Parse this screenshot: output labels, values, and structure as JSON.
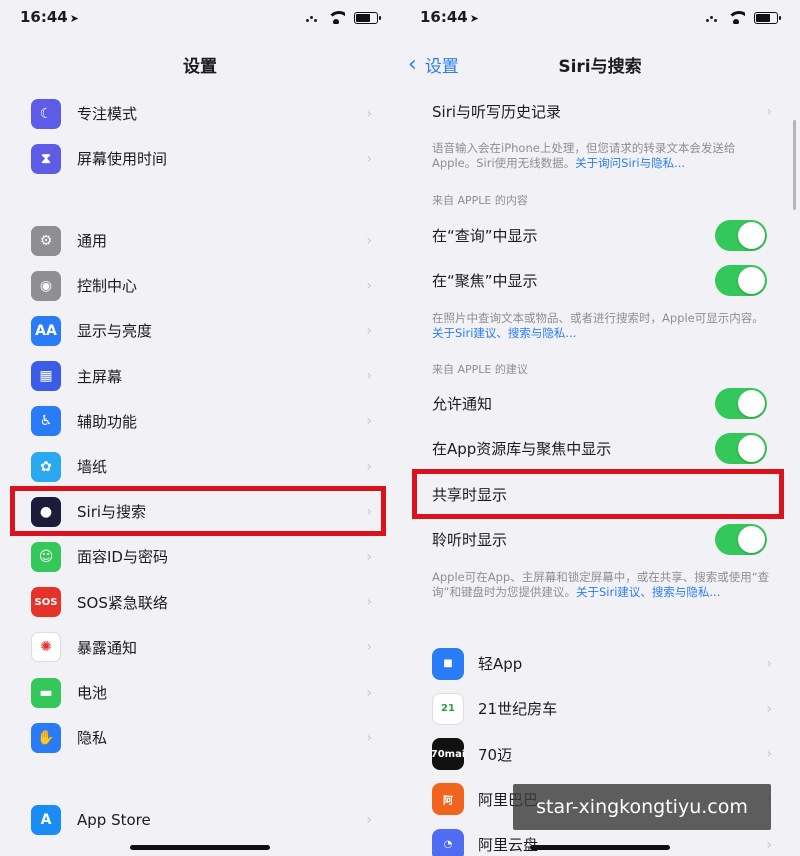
{
  "status": {
    "time": "16:44",
    "location_glyph": "➤"
  },
  "left": {
    "title": "设置",
    "group1": [
      {
        "label": "专注模式",
        "icon": "moon-icon",
        "color": "#5e5ce6",
        "glyph": "☾"
      },
      {
        "label": "屏幕使用时间",
        "icon": "hourglass-icon",
        "color": "#5e5ce6",
        "glyph": "⧗"
      }
    ],
    "group2": [
      {
        "label": "通用",
        "icon": "gear-icon",
        "color": "#8e8e93",
        "glyph": "⚙"
      },
      {
        "label": "控制中心",
        "icon": "toggles-icon",
        "color": "#8e8e93",
        "glyph": "◉"
      },
      {
        "label": "显示与亮度",
        "icon": "text-size-icon",
        "color": "#2a7cf6",
        "glyph": "AA"
      },
      {
        "label": "主屏幕",
        "icon": "home-grid-icon",
        "color": "#3a5ce6",
        "glyph": "▦"
      },
      {
        "label": "辅助功能",
        "icon": "accessibility-icon",
        "color": "#2a7cf6",
        "glyph": "♿"
      },
      {
        "label": "墙纸",
        "icon": "flower-icon",
        "color": "#2aa8f0",
        "glyph": "✿"
      },
      {
        "label": "Siri与搜索",
        "icon": "siri-icon",
        "color": "#1c1c3a",
        "glyph": "●"
      },
      {
        "label": "面容ID与密码",
        "icon": "face-id-icon",
        "color": "#34c759",
        "glyph": "☺"
      },
      {
        "label": "SOS紧急联络",
        "icon": "sos-icon",
        "color": "#e5332a",
        "glyph": "SOS"
      },
      {
        "label": "暴露通知",
        "icon": "exposure-icon",
        "color": "#ffffff",
        "glyph": "✺"
      },
      {
        "label": "电池",
        "icon": "battery-icon",
        "color": "#34c759",
        "glyph": "▬"
      },
      {
        "label": "隐私",
        "icon": "hand-icon",
        "color": "#2a7cf6",
        "glyph": "✋"
      }
    ],
    "group3": [
      {
        "label": "App Store",
        "icon": "app-store-icon",
        "color": "#1a8cf5",
        "glyph": "A"
      }
    ]
  },
  "right": {
    "back_label": "设置",
    "title": "Siri与搜索",
    "history_label": "Siri与听写历史记录",
    "history_footer_text": "语音输入会在iPhone上处理，但您请求的转录文本会发送给Apple。Siri使用无线数据。",
    "history_footer_link": "关于询问Siri与隐私...",
    "section1_header": "来自 APPLE 的内容",
    "show_in_lookup": "在“查询”中显示",
    "show_in_spotlight": "在“聚焦”中显示",
    "section1_footer_text": "在照片中查询文本或物品、或者进行搜索时，Apple可显示内容。",
    "section1_footer_link": "关于Siri建议、搜索与隐私...",
    "section2_header": "来自 APPLE 的建议",
    "allow_notifications": "允许通知",
    "show_in_library": "在App资源库与聚焦中显示",
    "show_when_sharing": "共享时显示",
    "show_when_listening": "聆听时显示",
    "section2_footer_text": "Apple可在App、主屏幕和锁定屏幕中，或在共享、搜索或使用“查询”和键盘时为您提供建议。",
    "section2_footer_link": "关于Siri建议、搜索与隐私...",
    "apps": [
      {
        "label": "轻App",
        "icon": "qing-app-icon",
        "color": "#2a7cf6",
        "glyph": "■"
      },
      {
        "label": "21世纪房车",
        "icon": "rv21-app-icon",
        "color": "#ffffff",
        "glyph": "21"
      },
      {
        "label": "70迈",
        "icon": "70mai-app-icon",
        "color": "#111111",
        "glyph": "70mai"
      },
      {
        "label": "阿里巴巴",
        "icon": "alibaba-app-icon",
        "color": "#f0641e",
        "glyph": "阿"
      },
      {
        "label": "阿里云盘",
        "icon": "aliyun-drive-app-icon",
        "color": "#4f6cf2",
        "glyph": "◔"
      }
    ]
  },
  "watermark": "star-xingkongtiyu.com"
}
